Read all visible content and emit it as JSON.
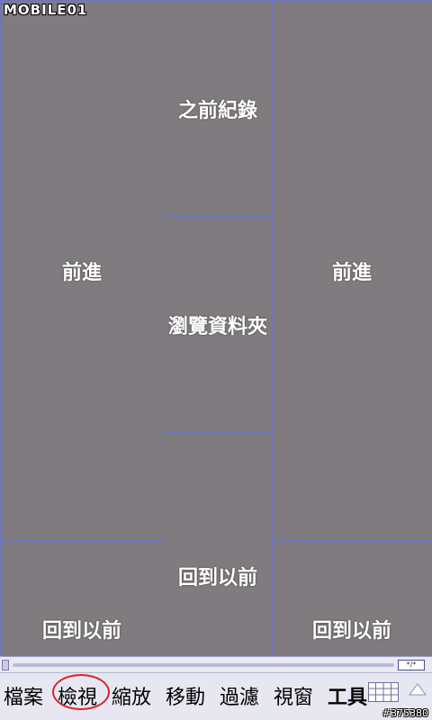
{
  "watermark": {
    "text": "MOBILE01",
    "image_id": "#375380"
  },
  "zones": {
    "history": "之前紀錄",
    "forward_left": "前進",
    "forward_right": "前進",
    "browse_folder": "瀏覽資料夾",
    "back_left": "回到以前",
    "back_center": "回到以前",
    "back_right": "回到以前"
  },
  "scrollbar": {
    "button_label": "*/*"
  },
  "menubar": {
    "items": [
      "檔案",
      "檢視",
      "縮放",
      "移動",
      "過濾",
      "視窗",
      "工具"
    ],
    "highlighted_index": 1
  },
  "colors": {
    "background": "#7f7b7f",
    "zone_border": "#6e72c4",
    "menubar_bg": "#e7e7f1",
    "highlight_circle": "#d6262f"
  },
  "icons": [
    "mobile01-logo-icon",
    "grid-icon",
    "up-arrow-icon"
  ]
}
